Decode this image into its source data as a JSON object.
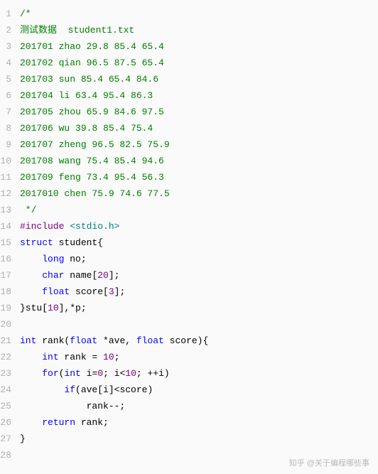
{
  "lines": [
    {
      "tokens": [
        {
          "c": "comment",
          "t": "/*"
        }
      ]
    },
    {
      "tokens": [
        {
          "c": "comment",
          "t": "测试数据  student1.txt"
        }
      ]
    },
    {
      "tokens": [
        {
          "c": "comment",
          "t": "201701 zhao 29.8 85.4 65.4"
        }
      ]
    },
    {
      "tokens": [
        {
          "c": "comment",
          "t": "201702 qian 96.5 87.5 65.4"
        }
      ]
    },
    {
      "tokens": [
        {
          "c": "comment",
          "t": "201703 sun 85.4 65.4 84.6"
        }
      ]
    },
    {
      "tokens": [
        {
          "c": "comment",
          "t": "201704 li 63.4 95.4 86.3"
        }
      ]
    },
    {
      "tokens": [
        {
          "c": "comment",
          "t": "201705 zhou 65.9 84.6 97.5"
        }
      ]
    },
    {
      "tokens": [
        {
          "c": "comment",
          "t": "201706 wu 39.8 85.4 75.4"
        }
      ]
    },
    {
      "tokens": [
        {
          "c": "comment",
          "t": "201707 zheng 96.5 82.5 75.9"
        }
      ]
    },
    {
      "tokens": [
        {
          "c": "comment",
          "t": "201708 wang 75.4 85.4 94.6"
        }
      ]
    },
    {
      "tokens": [
        {
          "c": "comment",
          "t": "201709 feng 73.4 95.4 56.3"
        }
      ]
    },
    {
      "tokens": [
        {
          "c": "comment",
          "t": "2017010 chen 75.9 74.6 77.5"
        }
      ]
    },
    {
      "tokens": [
        {
          "c": "comment",
          "t": " */"
        }
      ]
    },
    {
      "tokens": [
        {
          "c": "preprocessor",
          "t": "#include "
        },
        {
          "c": "include-str",
          "t": "<stdio.h>"
        }
      ]
    },
    {
      "tokens": [
        {
          "c": "keyword",
          "t": "struct"
        },
        {
          "c": "identifier",
          "t": " student{"
        }
      ]
    },
    {
      "tokens": [
        {
          "c": "identifier",
          "t": "    "
        },
        {
          "c": "type",
          "t": "long"
        },
        {
          "c": "identifier",
          "t": " no;"
        }
      ]
    },
    {
      "tokens": [
        {
          "c": "identifier",
          "t": "    "
        },
        {
          "c": "type",
          "t": "char"
        },
        {
          "c": "identifier",
          "t": " name["
        },
        {
          "c": "number",
          "t": "20"
        },
        {
          "c": "identifier",
          "t": "];"
        }
      ]
    },
    {
      "tokens": [
        {
          "c": "identifier",
          "t": "    "
        },
        {
          "c": "type",
          "t": "float"
        },
        {
          "c": "identifier",
          "t": " score["
        },
        {
          "c": "number",
          "t": "3"
        },
        {
          "c": "identifier",
          "t": "];"
        }
      ]
    },
    {
      "tokens": [
        {
          "c": "identifier",
          "t": "}stu["
        },
        {
          "c": "number",
          "t": "10"
        },
        {
          "c": "identifier",
          "t": "],*p;"
        }
      ]
    },
    {
      "tokens": [
        {
          "c": "identifier",
          "t": ""
        }
      ]
    },
    {
      "tokens": [
        {
          "c": "type",
          "t": "int"
        },
        {
          "c": "identifier",
          "t": " rank("
        },
        {
          "c": "type",
          "t": "float"
        },
        {
          "c": "identifier",
          "t": " *ave, "
        },
        {
          "c": "type",
          "t": "float"
        },
        {
          "c": "identifier",
          "t": " score){"
        }
      ]
    },
    {
      "tokens": [
        {
          "c": "identifier",
          "t": "    "
        },
        {
          "c": "type",
          "t": "int"
        },
        {
          "c": "identifier",
          "t": " rank = "
        },
        {
          "c": "number",
          "t": "10"
        },
        {
          "c": "identifier",
          "t": ";"
        }
      ]
    },
    {
      "tokens": [
        {
          "c": "identifier",
          "t": "    "
        },
        {
          "c": "keyword",
          "t": "for"
        },
        {
          "c": "identifier",
          "t": "("
        },
        {
          "c": "type",
          "t": "int"
        },
        {
          "c": "identifier",
          "t": " i="
        },
        {
          "c": "number",
          "t": "0"
        },
        {
          "c": "identifier",
          "t": "; i<"
        },
        {
          "c": "number",
          "t": "10"
        },
        {
          "c": "identifier",
          "t": "; ++i)"
        }
      ]
    },
    {
      "tokens": [
        {
          "c": "identifier",
          "t": "        "
        },
        {
          "c": "keyword",
          "t": "if"
        },
        {
          "c": "identifier",
          "t": "(ave[i]<score)"
        }
      ]
    },
    {
      "tokens": [
        {
          "c": "identifier",
          "t": "            rank--;"
        }
      ]
    },
    {
      "tokens": [
        {
          "c": "identifier",
          "t": "    "
        },
        {
          "c": "keyword",
          "t": "return"
        },
        {
          "c": "identifier",
          "t": " rank;"
        }
      ]
    },
    {
      "tokens": [
        {
          "c": "identifier",
          "t": "}"
        }
      ]
    },
    {
      "tokens": [
        {
          "c": "identifier",
          "t": ""
        }
      ]
    }
  ],
  "watermark": "知乎 @关于编程哪些事"
}
